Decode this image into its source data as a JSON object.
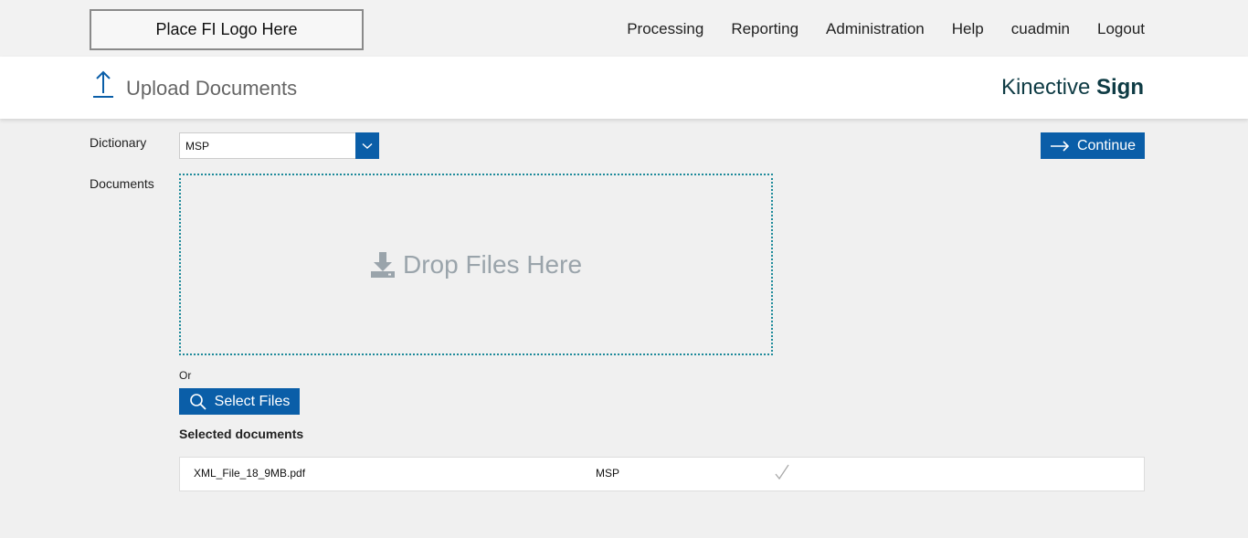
{
  "header": {
    "logo_text": "Place FI Logo Here",
    "nav": [
      "Processing",
      "Reporting",
      "Administration",
      "Help",
      "cuadmin",
      "Logout"
    ]
  },
  "titlebar": {
    "page_title": "Upload Documents",
    "brand_light": "Kinective",
    "brand_bold": "Sign",
    "upload_icon": "upload-arrow-icon"
  },
  "form": {
    "dictionary_label": "Dictionary",
    "dictionary_value": "MSP",
    "documents_label": "Documents",
    "continue_label": "Continue",
    "drop_text": "Drop Files Here",
    "or_text": "Or",
    "select_files_label": "Select Files"
  },
  "selected": {
    "heading": "Selected documents",
    "rows": [
      {
        "name": "XML_File_18_9MB.pdf",
        "dictionary": "MSP",
        "status_icon": "checkmark-icon"
      }
    ]
  },
  "colors": {
    "accent": "#0a5ea8",
    "brand": "#0e3b44",
    "dropzone_border": "#1d8a9a"
  }
}
